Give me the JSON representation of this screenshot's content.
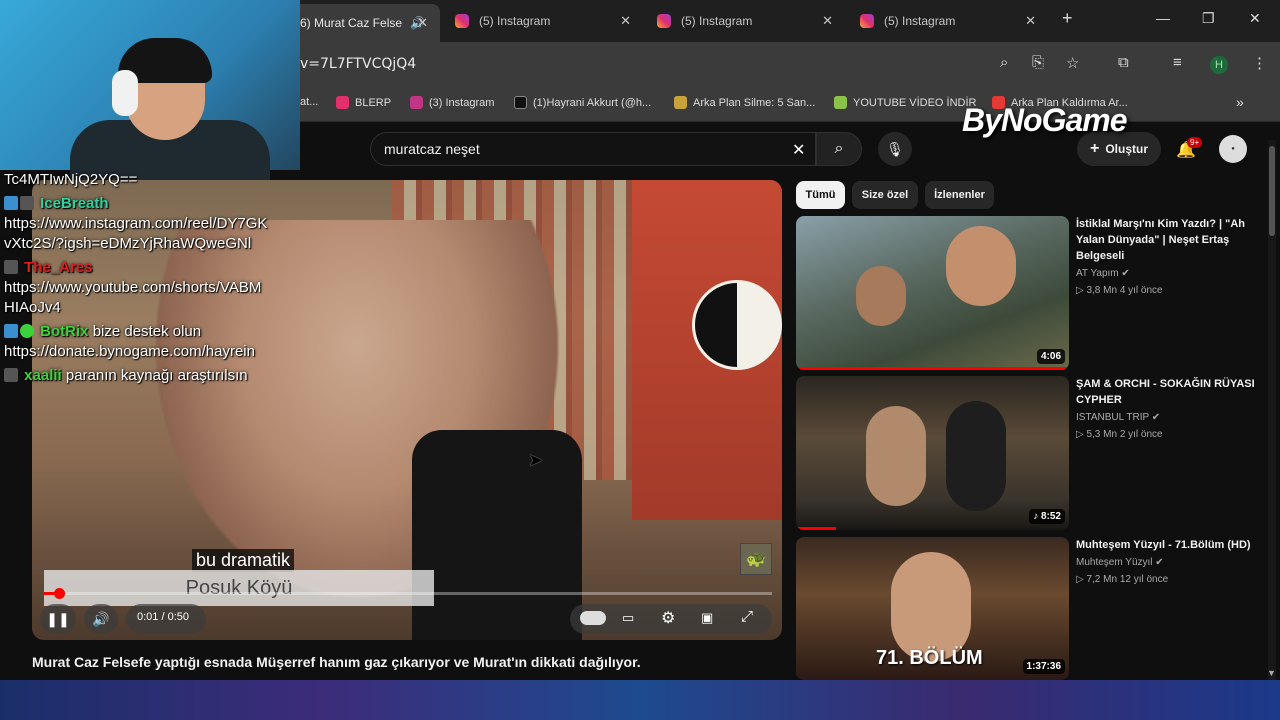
{
  "browser": {
    "tabs": [
      {
        "title": "6) Murat Caz Felse",
        "muted_icon": "🔊",
        "active": true
      },
      {
        "title": "(5) Instagram"
      },
      {
        "title": "(5) Instagram"
      },
      {
        "title": "(5) Instagram"
      }
    ],
    "new_tab": "+",
    "window_controls": {
      "minimize": "—",
      "maximize": "❐",
      "close": "✕"
    },
    "url": "v=7L7FTVCQjQ4",
    "bookmarks": [
      {
        "label": "at...",
        "color": "#e8a23a"
      },
      {
        "label": "BLERP",
        "color": "#e1306c"
      },
      {
        "label": "(3) Instagram",
        "color": "#c13584"
      },
      {
        "label": "(1)Hayrani Akkurt (@h...",
        "color": "#222222"
      },
      {
        "label": "Arka Plan Silme: 5 San...",
        "color": "#c9a23a"
      },
      {
        "label": "YOUTUBE VİDEO İNDİR",
        "color": "#8bc34a"
      },
      {
        "label": "Arka Plan Kaldırma Ar...",
        "color": "#e53935"
      }
    ],
    "profile_letter": "H"
  },
  "youtube": {
    "search_value": "muratcaz neşet",
    "create_label": "Oluştur",
    "notif_count": "9+",
    "chips": [
      "Tümü",
      "Size özel",
      "İzlenenler"
    ],
    "video": {
      "title": "Murat Caz Felsefe yaptığı esnada Müşerref hanım gaz çıkarıyor ve Murat'ın dikkati dağılıyor.",
      "caption1": "bu dramatik",
      "caption2": "Posuk Köyü",
      "time": "0:01 / 0:50",
      "progress": 0.02
    },
    "suggestions": [
      {
        "title": "İstiklal Marşı'nı Kim Yazdı? | \"Ah Yalan Dünyada\" | Neşet Ertaş Belgeseli",
        "channel": "AT Yapım",
        "meta": "▷ 3,8 Mn   4 yıl önce",
        "duration": "4:06"
      },
      {
        "title": "ŞAM & ORCHI - SOKAĞIN RÜYASI CYPHER",
        "channel": "ISTANBUL TRIP",
        "meta": "▷ 5,3 Mn   2 yıl önce",
        "duration": "♪ 8:52"
      },
      {
        "title": "Muhteşem Yüzyıl - 71.Bölüm (HD)",
        "channel": "Muhteşem Yüzyıl",
        "meta": "▷ 7,2 Mn   12 yıl önce",
        "duration": "1:37:36"
      }
    ]
  },
  "overlay": {
    "logo": "ByNoGame",
    "chat": [
      {
        "user": "",
        "text": "Tc4MTIwNjQ2YQ=="
      },
      {
        "user": "IceBreath",
        "user_color": "#2fd1a0",
        "text": ""
      },
      {
        "user": "",
        "text": "https://www.instagram.com/reel/DY7GK"
      },
      {
        "user": "",
        "text": "vXtc2S/?igsh=eDMzYjRhaWQweGNl"
      },
      {
        "user": "The_Ares",
        "user_color": "#e02020",
        "text": ""
      },
      {
        "user": "",
        "text": "https://www.youtube.com/shorts/VABM"
      },
      {
        "user": "",
        "text": "HIAoJv4"
      },
      {
        "user": "BotRix",
        "user_color": "#3cd23c",
        "text": "bize destek olun"
      },
      {
        "user": "",
        "text": "https://donate.bynogame.com/hayrein"
      },
      {
        "user": "xaalii",
        "user_color": "#3cd23c",
        "text": "paranın kaynağı araştırılsın"
      }
    ]
  }
}
